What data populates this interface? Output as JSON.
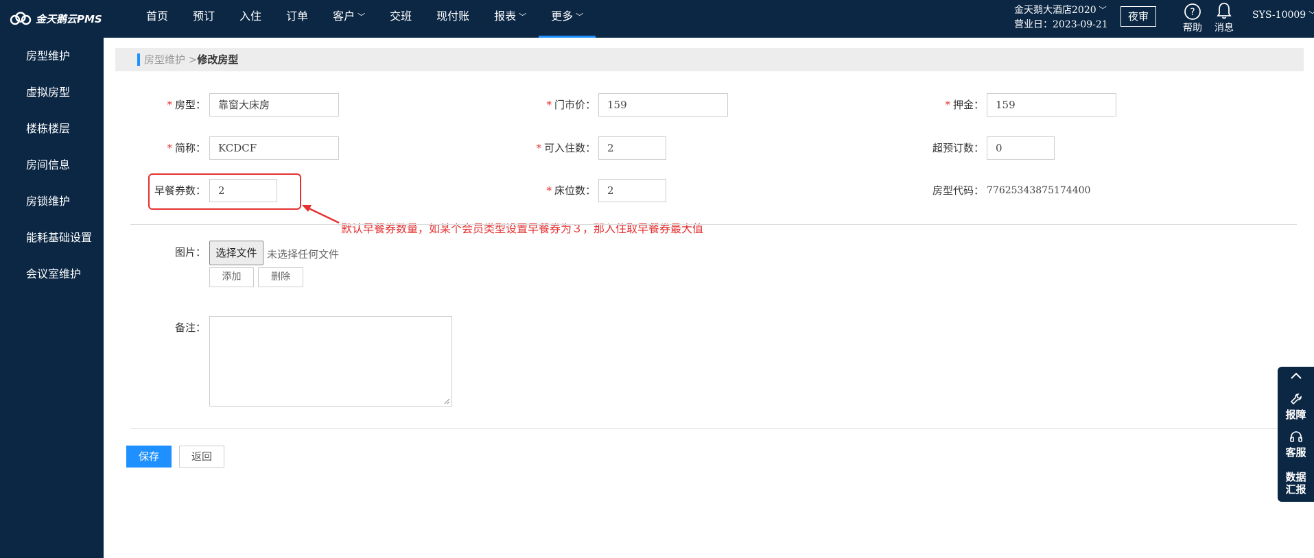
{
  "app": {
    "logo_text": "金天鹅云PMS"
  },
  "nav": [
    {
      "label": "首页",
      "dropdown": false
    },
    {
      "label": "预订",
      "dropdown": false
    },
    {
      "label": "入住",
      "dropdown": false
    },
    {
      "label": "订单",
      "dropdown": false
    },
    {
      "label": "客户",
      "dropdown": true
    },
    {
      "label": "交班",
      "dropdown": false
    },
    {
      "label": "现付账",
      "dropdown": false
    },
    {
      "label": "报表",
      "dropdown": true
    },
    {
      "label": "更多",
      "dropdown": true,
      "active": true
    }
  ],
  "header": {
    "hotel_name": "金天鹅大酒店2020",
    "business_date": "营业日：2023-09-21",
    "night_audit": "夜审",
    "help": "帮助",
    "messages": "消息",
    "user": "SYS-10009"
  },
  "sidebar": {
    "items": [
      {
        "label": "房型维护"
      },
      {
        "label": "虚拟房型"
      },
      {
        "label": "楼栋楼层"
      },
      {
        "label": "房间信息"
      },
      {
        "label": "房锁维护"
      },
      {
        "label": "能耗基础设置"
      },
      {
        "label": "会议室维护"
      }
    ]
  },
  "breadcrumb": {
    "parent": "房型维护 >",
    "current": "修改房型"
  },
  "form": {
    "room_type": {
      "label": "房型：",
      "value": "靠窗大床房"
    },
    "rack_price": {
      "label": "门市价：",
      "value": "159"
    },
    "deposit": {
      "label": "押金：",
      "value": "159"
    },
    "short_name": {
      "label": "简称：",
      "value": "KCDCF"
    },
    "max_guests": {
      "label": "可入住数：",
      "value": "2"
    },
    "overbook": {
      "label": "超预订数：",
      "value": "0"
    },
    "breakfast": {
      "label": "早餐券数：",
      "value": "2"
    },
    "beds": {
      "label": "床位数：",
      "value": "2"
    },
    "code": {
      "label": "房型代码：",
      "value": "77625343875174400"
    },
    "image": {
      "label": "图片：",
      "choose": "选择文件",
      "none": "未选择任何文件",
      "add": "添加",
      "delete": "删除"
    },
    "remark": {
      "label": "备注：",
      "value": ""
    },
    "required_mark": "*"
  },
  "annotation": "默认早餐券数量，如某个会员类型设置早餐券为３，那入住取早餐券最大值",
  "actions": {
    "save": "保存",
    "back": "返回"
  },
  "float_panel": {
    "report": "报障",
    "service": "客服",
    "data_line1": "数据",
    "data_line2": "汇报"
  },
  "colors": {
    "nav_bg": "#0b2744",
    "accent": "#1e90ff",
    "annotation": "#e53030"
  }
}
